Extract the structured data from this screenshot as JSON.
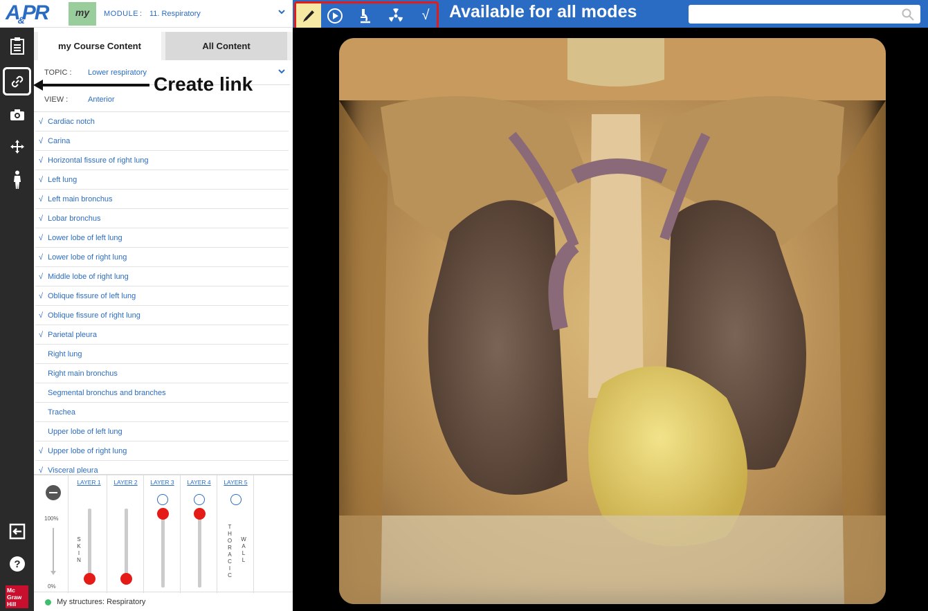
{
  "brand": {
    "logo_a": "A",
    "logo_amp": "&",
    "logo_pr": "PR",
    "my_badge": "my",
    "publisher": [
      "Mc",
      "Graw",
      "Hill"
    ]
  },
  "module": {
    "label": "MODULE",
    "separator": ":",
    "value": "11. Respiratory"
  },
  "tabs": [
    {
      "label": "my Course Content",
      "active": true
    },
    {
      "label": "All Content",
      "active": false
    }
  ],
  "topic": {
    "label": "TOPIC  :",
    "value": "Lower respiratory"
  },
  "view": {
    "label": "VIEW  :",
    "value": "Anterior"
  },
  "structures": [
    {
      "label": "Cardiac notch",
      "checked": true
    },
    {
      "label": "Carina",
      "checked": true
    },
    {
      "label": "Horizontal fissure of right lung",
      "checked": true
    },
    {
      "label": "Left lung",
      "checked": true
    },
    {
      "label": "Left main bronchus",
      "checked": true
    },
    {
      "label": "Lobar bronchus",
      "checked": true
    },
    {
      "label": "Lower lobe of left lung",
      "checked": true
    },
    {
      "label": "Lower lobe of right lung",
      "checked": true
    },
    {
      "label": "Middle lobe of right lung",
      "checked": true
    },
    {
      "label": "Oblique fissure of left lung",
      "checked": true
    },
    {
      "label": "Oblique fissure of right lung",
      "checked": true
    },
    {
      "label": "Parietal pleura",
      "checked": true
    },
    {
      "label": "Right lung",
      "checked": false
    },
    {
      "label": "Right main bronchus",
      "checked": false
    },
    {
      "label": "Segmental bronchus and branches",
      "checked": false
    },
    {
      "label": "Trachea",
      "checked": false
    },
    {
      "label": "Upper lobe of left lung",
      "checked": false
    },
    {
      "label": "Upper lobe of right lung",
      "checked": true
    },
    {
      "label": "Visceral pleura",
      "checked": true
    }
  ],
  "check_glyph": "√",
  "opacity": {
    "max_label": "100%",
    "min_label": "0%"
  },
  "layers": [
    {
      "label": "LAYER 1",
      "name": "SKIN",
      "level": 0
    },
    {
      "label": "LAYER 2",
      "name": "",
      "level": 0
    },
    {
      "label": "LAYER 3",
      "name": "",
      "level": 1
    },
    {
      "label": "LAYER 4",
      "name": "",
      "level": 1
    },
    {
      "label": "LAYER 5",
      "name": "THORACIC WALL",
      "level": null
    }
  ],
  "my_structures": "My structures: Respiratory",
  "toolbar": {
    "modes": [
      "pencil-icon",
      "play-icon",
      "microscope-icon",
      "radiation-icon",
      "check-icon"
    ],
    "check_glyph": "√",
    "caption": "Available for all modes"
  },
  "search": {
    "placeholder": ""
  },
  "callout": {
    "text": "Create link"
  },
  "colors": {
    "accent": "#2a6cc4",
    "highlight": "#e41b17",
    "sidebar": "#2a2a2a",
    "my_badge": "#9acd9c"
  }
}
